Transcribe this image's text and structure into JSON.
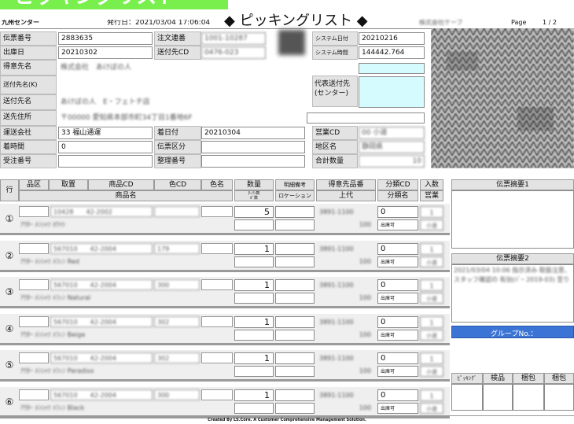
{
  "header": {
    "center": "九州センター",
    "issued": "発行日：2021/03/04 17:06:04",
    "title": "◆ ピッキングリスト ◆",
    "company": "株式会社ケーブ",
    "page_label": "Page",
    "page_value": "1 / 2",
    "banner": "ピッキングリスト"
  },
  "labels": {
    "slip_no": "伝票番号",
    "ship_date": "出庫日",
    "customer": "得意先名",
    "dest_kana": "送付先名(K)",
    "dest": "送付先名",
    "dest_addr": "送先住所",
    "carrier": "運送会社",
    "arrival_time": "着時間",
    "order_no": "受注番号",
    "order_contact": "注文連番",
    "dest_cd": "送付先CD",
    "arrival_date": "着日付",
    "slip_class": "伝票区分",
    "adj_no": "整理番号",
    "sys_date": "システム日付",
    "sys_time": "システム時間",
    "rep_dest": "代表送付先\n(センター)",
    "sales_cd": "営業CD",
    "area": "地区名",
    "total_qty": "合計数量"
  },
  "values": {
    "slip_no": "2883635",
    "ship_date": "20210302",
    "carrier": "33 福山通運",
    "arrival_time": "0",
    "arrival_date": "20210304",
    "sys_date": "20210216",
    "sys_time": "144442.764",
    "order_contact": "1001-10287",
    "dest_cd": "0476-023",
    "customer": "株式会社　あけぼの人",
    "dest": "あけぼの人　E・フェトチ店",
    "dest_addr": "〒00000 愛知県本部市町34丁目1番地6F",
    "sales_cd": "00 小道",
    "area": "静岡県",
    "total_qty": "10"
  },
  "columns": {
    "row": "行",
    "area": "品区",
    "take": "取置",
    "product_cd": "商品CD",
    "color_cd": "色CD",
    "color": "色名",
    "qty": "数量",
    "qty_sub": "ﾀｰﾘﾝ数\nｶﾞ数",
    "detail_note": "明細備考",
    "location": "ロケーション",
    "cust_item_no": "得意先品番",
    "upper": "上代",
    "class_cd": "分類CD",
    "class_name": "分類名",
    "count": "入数",
    "sales": "営業"
  },
  "items": [
    {
      "row": "①",
      "product_cd": "10428　　42-2002",
      "color_cd": "",
      "name": "ｱｳﾀｰ ﾒﾝｼｬﾂ ﾎﾜｲﾄ",
      "qty": "5",
      "cust_item_no": "3891-1100",
      "upper": "100",
      "class_cd": "0",
      "class_name": "出庫可",
      "count": "1",
      "sales": "小道"
    },
    {
      "row": "②",
      "product_cd": "567010　　42-2004",
      "color_cd": "179",
      "name": "ｱｳﾀｰ ﾒﾝｼｬﾂ ﾒﾌｨﾝ Red",
      "qty": "1",
      "cust_item_no": "3891-1100",
      "upper": "100",
      "class_cd": "0",
      "class_name": "出庫可",
      "count": "1",
      "sales": "小道"
    },
    {
      "row": "③",
      "product_cd": "567010　　42-2004",
      "color_cd": "300",
      "name": "ｱｳﾀｰ ﾒﾝｼｬﾂ ﾒﾌｨﾝ Natural",
      "qty": "1",
      "cust_item_no": "3891-1100",
      "upper": "100",
      "class_cd": "0",
      "class_name": "出庫可",
      "count": "1",
      "sales": "小道"
    },
    {
      "row": "④",
      "product_cd": "567010　　42-2004",
      "color_cd": "302",
      "name": "ｱｳﾀｰ ﾒﾝｼｬﾂ ﾒﾌｨﾝ Beige",
      "qty": "1",
      "cust_item_no": "3891-1100",
      "upper": "100",
      "class_cd": "0",
      "class_name": "出庫可",
      "count": "1",
      "sales": "小道"
    },
    {
      "row": "⑤",
      "product_cd": "567010　　42-2004",
      "color_cd": "302",
      "name": "ｱｳﾀｰ ﾒﾝｼｬﾂ ﾒﾌｨﾝ Paradiso",
      "qty": "1",
      "cust_item_no": "3891-1100",
      "upper": "100",
      "class_cd": "0",
      "class_name": "出庫可",
      "count": "1",
      "sales": "小道"
    },
    {
      "row": "⑥",
      "product_cd": "567010　　42-2004",
      "color_cd": "300",
      "name": "ｱｳﾀｰ ﾒﾝｼｬﾂ ﾒﾌｨﾝ Black",
      "qty": "1",
      "cust_item_no": "3891-1100",
      "upper": "100",
      "class_cd": "0",
      "class_name": "出庫可",
      "count": "1",
      "sales": "小道"
    }
  ],
  "side": {
    "memo1_title": "伝票摘要1",
    "memo2_title": "伝票摘要2",
    "memo2_text": "2021/03/04 10:06 指示済み 取扱注意、スタッフ確認の 有効(ﾊﾞｰ 2019-03) 至り",
    "group_label": "グループNo.：",
    "picking": "ﾋﾟｯｷﾝｸﾞ",
    "inspect": "検品",
    "pack1": "梱包",
    "pack2": "梱包"
  },
  "footer": "Created By LS.Core. A Customer Comprehensive Management Solution.",
  "colors": {
    "accent_blue": "#3c74d6",
    "light_cyan": "#d6fbfe",
    "banner_green": "#79ef4e",
    "header_gray": "#e3e3e3"
  }
}
